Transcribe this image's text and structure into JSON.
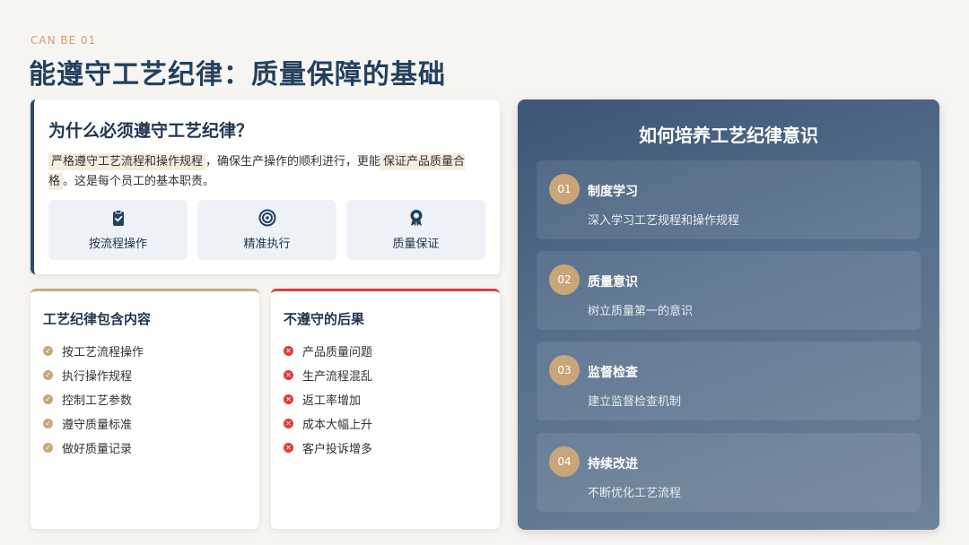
{
  "header": {
    "eyebrow": "CAN BE 01",
    "title": "能遵守工艺纪律：质量保障的基础"
  },
  "why": {
    "title": "为什么必须遵守工艺纪律？",
    "text_hl1": "严格遵守工艺流程和操作规程",
    "text_mid": "，确保生产操作的顺利进行，更能",
    "text_hl2": "保证产品质量合格",
    "text_end": "。这是每个员工的基本职责。",
    "boxes": [
      {
        "label": "按流程操作",
        "icon": "clipboard-check-icon"
      },
      {
        "label": "精准执行",
        "icon": "target-icon"
      },
      {
        "label": "质量保证",
        "icon": "award-ribbon-icon"
      }
    ]
  },
  "contents": {
    "title": "工艺纪律包含内容",
    "items": [
      "按工艺流程操作",
      "执行操作规程",
      "控制工艺参数",
      "遵守质量标准",
      "做好质量记录"
    ]
  },
  "consequences": {
    "title": "不遵守的后果",
    "items": [
      "产品质量问题",
      "生产流程混乱",
      "返工率增加",
      "成本大幅上升",
      "客户投诉增多"
    ]
  },
  "panel": {
    "title": "如何培养工艺纪律意识",
    "steps": [
      {
        "num": "01",
        "title": "制度学习",
        "desc": "深入学习工艺规程和操作规程"
      },
      {
        "num": "02",
        "title": "质量意识",
        "desc": "树立质量第一的意识"
      },
      {
        "num": "03",
        "title": "监督检查",
        "desc": "建立监督检查机制"
      },
      {
        "num": "04",
        "title": "持续改进",
        "desc": "不断优化工艺流程"
      }
    ]
  },
  "colors": {
    "accent_gold": "#c8a97e",
    "accent_red": "#e23a3a",
    "navy": "#24405f"
  }
}
